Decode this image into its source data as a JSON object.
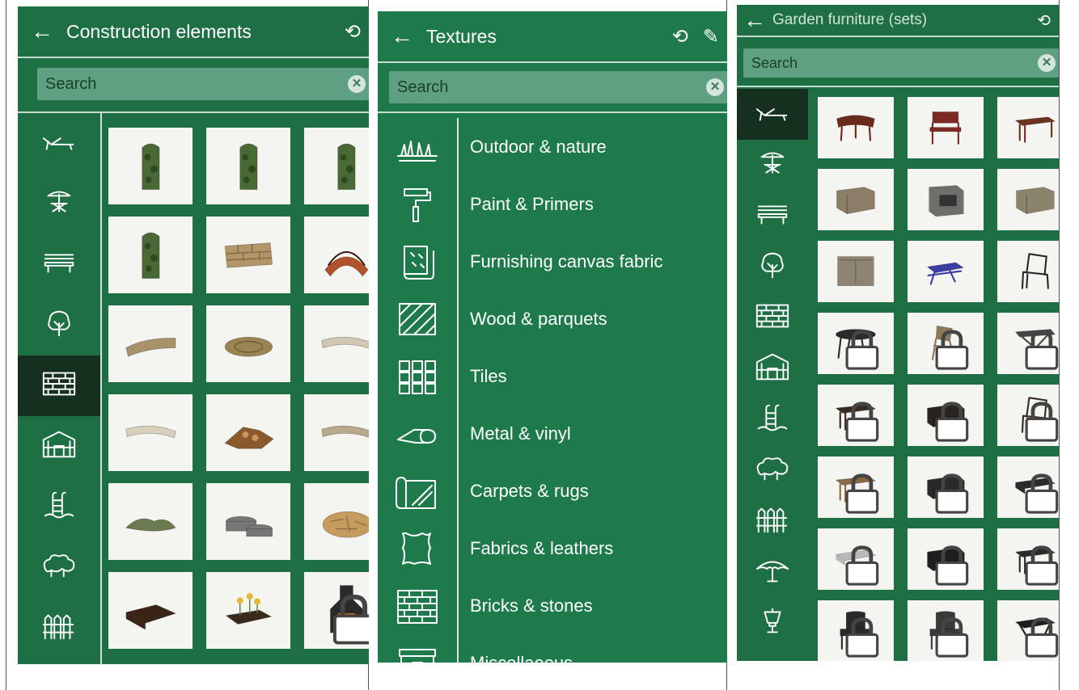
{
  "panel1": {
    "title": "Construction elements",
    "back_icon": "back-arrow-icon",
    "history_icon": "history-icon",
    "search_placeholder": "Search",
    "clear_icon": "clear-icon",
    "categories": [
      {
        "icon": "lounger-icon"
      },
      {
        "icon": "parasol-table-icon"
      },
      {
        "icon": "bench-icon"
      },
      {
        "icon": "tree-icon"
      },
      {
        "icon": "brick-wall-icon",
        "selected": true
      },
      {
        "icon": "greenhouse-icon"
      },
      {
        "icon": "pool-ladder-icon"
      },
      {
        "icon": "bushes-icon"
      },
      {
        "icon": "fence-icon"
      }
    ],
    "items": [
      {
        "icon": "ivy-trellis-icon",
        "color": "#4a6a35"
      },
      {
        "icon": "ivy-trellis-icon",
        "color": "#4a6a35"
      },
      {
        "icon": "ivy-trellis-icon",
        "color": "#4a6a35"
      },
      {
        "icon": "ivy-trellis-icon",
        "color": "#4a6a35"
      },
      {
        "icon": "stone-wall-icon",
        "color": "#b49568"
      },
      {
        "icon": "wooden-bridge-icon",
        "color": "#b0532a"
      },
      {
        "icon": "curved-stone-wall-icon",
        "color": "#a9916a"
      },
      {
        "icon": "round-stone-pavement-icon",
        "color": "#9a8451"
      },
      {
        "icon": "stone-border-icon",
        "color": "#cfc7b3"
      },
      {
        "icon": "stone-border-icon",
        "color": "#d8d0bb"
      },
      {
        "icon": "log-pile-icon",
        "color": "#8a5a2c"
      },
      {
        "icon": "stone-border-icon",
        "color": "#b8a98a"
      },
      {
        "icon": "rock-garden-icon",
        "color": "#6b7a50"
      },
      {
        "icon": "planter-pots-icon",
        "color": "#777777"
      },
      {
        "icon": "flagstone-icon",
        "color": "#c69b5e"
      },
      {
        "icon": "raised-bed-icon",
        "color": "#3a2418"
      },
      {
        "icon": "flower-planter-icon",
        "color": "#3b2a1c"
      },
      {
        "icon": "outdoor-fireplace-icon",
        "color": "#2a2a2a",
        "locked": true
      }
    ]
  },
  "panel2": {
    "title": "Textures",
    "back_icon": "back-arrow-icon",
    "history_icon": "history-icon",
    "eyedropper_icon": "eyedropper-icon",
    "search_placeholder": "Search",
    "clear_icon": "clear-icon",
    "categories": [
      {
        "icon": "grass-icon",
        "label": "Outdoor & nature"
      },
      {
        "icon": "paint-roller-icon",
        "label": "Paint & Primers"
      },
      {
        "icon": "fabric-roll-icon",
        "label": "Furnishing canvas fabric"
      },
      {
        "icon": "wood-planks-icon",
        "label": "Wood & parquets"
      },
      {
        "icon": "tiles-icon",
        "label": "Tiles"
      },
      {
        "icon": "vinyl-roll-icon",
        "label": "Metal & vinyl"
      },
      {
        "icon": "carpet-roll-icon",
        "label": "Carpets & rugs"
      },
      {
        "icon": "leather-hide-icon",
        "label": "Fabrics & leathers"
      },
      {
        "icon": "bricks-icon",
        "label": "Bricks & stones"
      },
      {
        "icon": "box-icon",
        "label": "Miscellaeous"
      }
    ]
  },
  "panel3": {
    "title": "Garden furniture (sets)",
    "back_icon": "back-arrow-icon",
    "history_icon": "history-icon",
    "search_placeholder": "Search",
    "clear_icon": "clear-icon",
    "categories": [
      {
        "icon": "lounger-icon",
        "selected": true
      },
      {
        "icon": "parasol-table-icon"
      },
      {
        "icon": "bench-icon"
      },
      {
        "icon": "tree-icon"
      },
      {
        "icon": "brick-wall-icon"
      },
      {
        "icon": "greenhouse-icon"
      },
      {
        "icon": "pool-ladder-icon"
      },
      {
        "icon": "bushes-icon"
      },
      {
        "icon": "fence-icon"
      },
      {
        "icon": "parasol-icon"
      },
      {
        "icon": "lamp-icon"
      }
    ],
    "items": [
      {
        "icon": "curved-bench-icon",
        "color": "#6b2a1e"
      },
      {
        "icon": "wooden-chair-icon",
        "color": "#7a2a22"
      },
      {
        "icon": "long-table-icon",
        "color": "#6e3020"
      },
      {
        "icon": "outdoor-kitchen-icon",
        "color": "#8b7d66"
      },
      {
        "icon": "grill-station-icon",
        "color": "#6f6f6a"
      },
      {
        "icon": "outdoor-kitchen-icon",
        "color": "#8c836d"
      },
      {
        "icon": "kitchen-cabinet-icon",
        "color": "#8e8473"
      },
      {
        "icon": "picnic-table-icon",
        "color": "#3b3fa3"
      },
      {
        "icon": "armchair-icon",
        "color": "#2a2a2a"
      },
      {
        "icon": "round-table-icon",
        "color": "#2b2b2b",
        "locked": true
      },
      {
        "icon": "folding-chair-icon",
        "color": "#8e7a5a",
        "locked": true
      },
      {
        "icon": "folding-table-icon",
        "color": "#444444",
        "locked": true
      },
      {
        "icon": "long-table-icon",
        "color": "#3a2a22",
        "locked": true
      },
      {
        "icon": "sofa-icon",
        "color": "#2a2320",
        "locked": true
      },
      {
        "icon": "armchair-icon",
        "color": "#3a2a25",
        "locked": true
      },
      {
        "icon": "long-table-icon",
        "color": "#8a6a45",
        "locked": true
      },
      {
        "icon": "sofa-icon",
        "color": "#2a2a2a",
        "locked": true
      },
      {
        "icon": "low-table-icon",
        "color": "#2a2a2a",
        "locked": true
      },
      {
        "icon": "low-table-icon",
        "color": "#b9b9b9",
        "locked": true
      },
      {
        "icon": "sofa-icon",
        "color": "#1e1e1e",
        "locked": true
      },
      {
        "icon": "long-table-icon",
        "color": "#2a2a2a",
        "locked": true
      },
      {
        "icon": "wicker-chair-icon",
        "color": "#2a2a2a",
        "locked": true
      },
      {
        "icon": "wicker-chair-icon",
        "color": "#3a3a3a",
        "locked": true
      },
      {
        "icon": "patio-table-icon",
        "color": "#1e1e1e",
        "locked": true
      }
    ]
  }
}
